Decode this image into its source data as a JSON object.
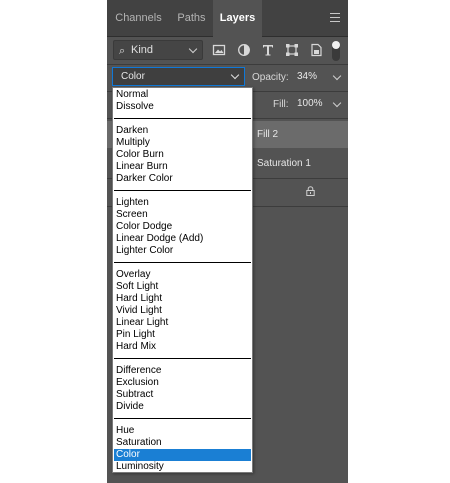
{
  "tabs": [
    {
      "label": "Channels",
      "active": false
    },
    {
      "label": "Paths",
      "active": false
    },
    {
      "label": "Layers",
      "active": true
    }
  ],
  "filter": {
    "kind_label": "Kind",
    "icons": [
      "image-filter-icon",
      "adjustment-filter-icon",
      "type-filter-icon",
      "shape-filter-icon",
      "smart-object-filter-icon"
    ]
  },
  "blend": {
    "mode": "Color",
    "opacity_label": "Opacity:",
    "opacity_value": "34%",
    "fill_label": "Fill:",
    "fill_value": "100%"
  },
  "layers": [
    {
      "name": "Fill 2",
      "selected": true
    },
    {
      "name": "Saturation 1",
      "selected": false
    },
    {
      "name": "",
      "selected": false,
      "locked": true
    }
  ],
  "blend_modes": {
    "groups": [
      [
        "Normal",
        "Dissolve"
      ],
      [
        "Darken",
        "Multiply",
        "Color Burn",
        "Linear Burn",
        "Darker Color"
      ],
      [
        "Lighten",
        "Screen",
        "Color Dodge",
        "Linear Dodge (Add)",
        "Lighter Color"
      ],
      [
        "Overlay",
        "Soft Light",
        "Hard Light",
        "Vivid Light",
        "Linear Light",
        "Pin Light",
        "Hard Mix"
      ],
      [
        "Difference",
        "Exclusion",
        "Subtract",
        "Divide"
      ],
      [
        "Hue",
        "Saturation",
        "Color",
        "Luminosity"
      ]
    ],
    "highlighted": "Color"
  },
  "colors": {
    "panel_bg": "#535353",
    "highlight": "#1a7fd4",
    "focus_border": "#0f78d8"
  }
}
